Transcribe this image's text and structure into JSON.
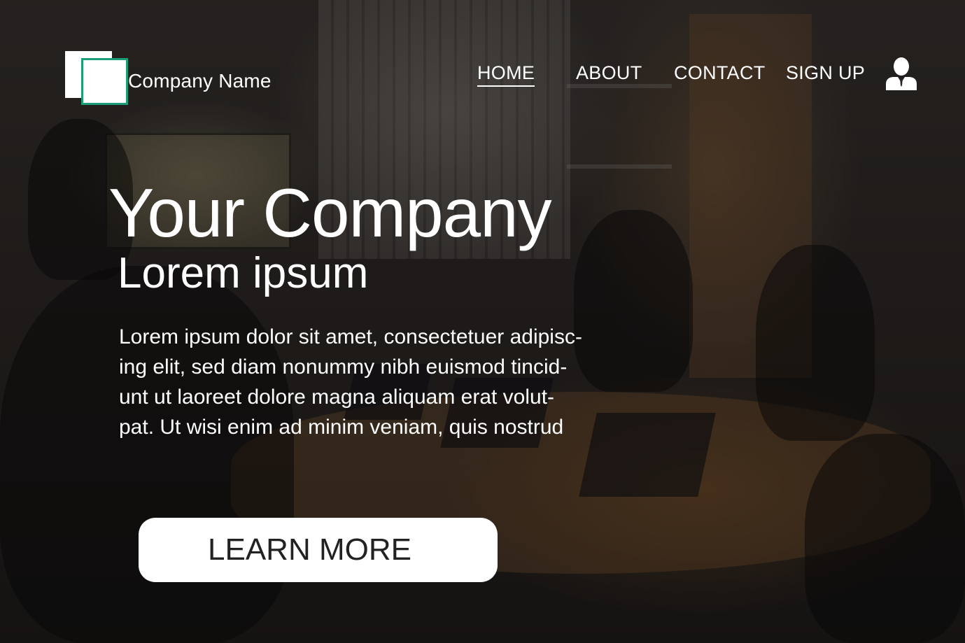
{
  "header": {
    "company_name": "Company Name",
    "logo_icon": "logo-squares-icon",
    "accent_color": "#1b9e77",
    "nav": [
      {
        "label": "HOME",
        "active": true
      },
      {
        "label": "ABOUT",
        "active": false
      },
      {
        "label": "CONTACT",
        "active": false
      },
      {
        "label": "SIGN UP",
        "active": false
      }
    ],
    "user_icon": "user-icon"
  },
  "hero": {
    "title": "Your Company",
    "subtitle": "Lorem ipsum",
    "body_lines": [
      "Lorem ipsum dolor sit amet, consectetuer adipisc-",
      "ing elit, sed diam nonummy nibh euismod tincid-",
      "unt ut laoreet dolore magna aliquam erat volut-",
      "pat. Ut wisi enim ad minim veniam, quis nostrud"
    ],
    "cta_label": "LEARN MORE"
  }
}
